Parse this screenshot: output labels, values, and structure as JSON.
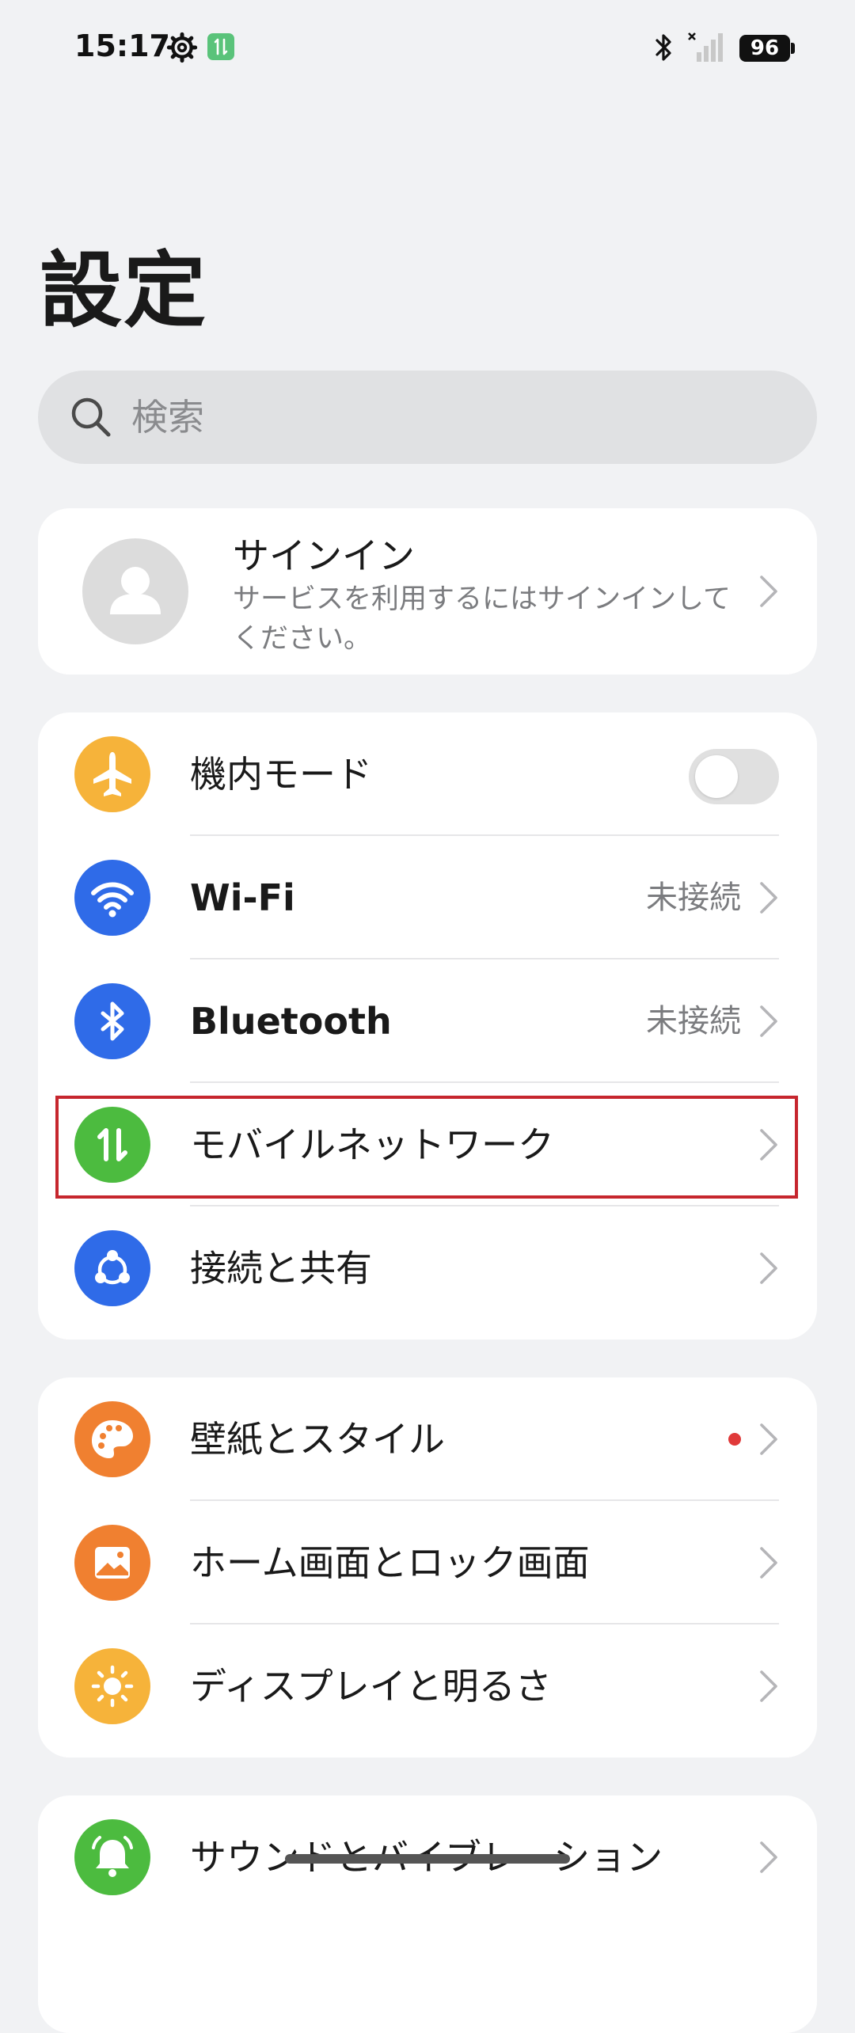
{
  "status_bar": {
    "time": "15:17",
    "battery": "96",
    "icons": [
      "gear-icon",
      "data-transfer-icon",
      "bluetooth-icon",
      "no-signal-icon",
      "battery-icon"
    ]
  },
  "title": "設定",
  "search": {
    "placeholder": "検索"
  },
  "account": {
    "title": "サインイン",
    "subtitle": "サービスを利用するにはサインインしてください。"
  },
  "network_group": [
    {
      "label": "機内モード",
      "icon": "airplane-icon",
      "color": "#f6b33a",
      "toggle": false
    },
    {
      "label": "Wi-Fi",
      "icon": "wifi-icon",
      "color": "#2f6be8",
      "status": "未接続"
    },
    {
      "label": "Bluetooth",
      "icon": "bluetooth-icon",
      "color": "#2f6be8",
      "status": "未接続"
    },
    {
      "label": "モバイルネットワーク",
      "icon": "mobile-data-icon",
      "color": "#4cbb3f",
      "highlighted": true
    },
    {
      "label": "接続と共有",
      "icon": "share-icon",
      "color": "#2f6be8"
    }
  ],
  "display_group": [
    {
      "label": "壁紙とスタイル",
      "icon": "palette-icon",
      "color": "#f08030",
      "badge": "red-dot"
    },
    {
      "label": "ホーム画面とロック画面",
      "icon": "wallpaper-icon",
      "color": "#f08030"
    },
    {
      "label": "ディスプレイと明るさ",
      "icon": "brightness-icon",
      "color": "#f6b33a"
    }
  ],
  "sound_group": [
    {
      "label": "サウンドとバイブレーション",
      "icon": "bell-icon",
      "color": "#4cbb3f"
    }
  ],
  "colors": {
    "background": "#f1f2f4",
    "highlight_border": "#c6262e"
  }
}
